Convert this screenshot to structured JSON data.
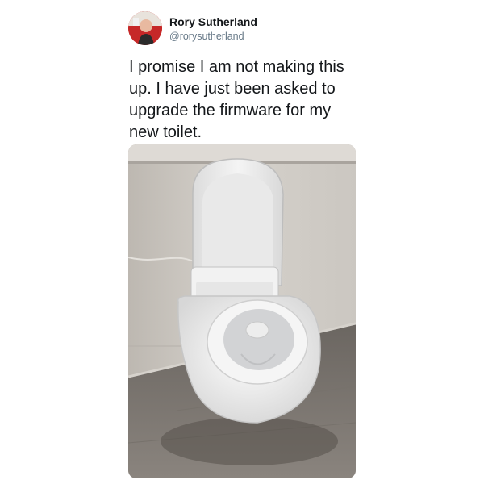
{
  "tweet": {
    "author_name": "Rory Sutherland",
    "author_handle": "@rorysutherland",
    "text": "I promise I am not making this up. I have just been asked to upgrade the firmware for my new toilet."
  },
  "media": {
    "icon": "photo-toilet"
  }
}
